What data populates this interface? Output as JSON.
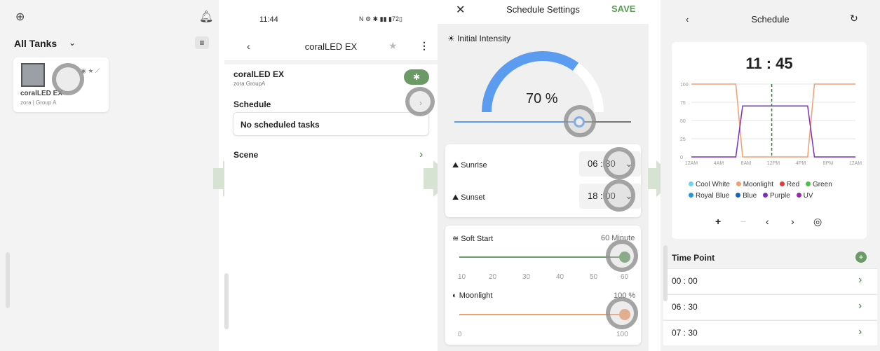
{
  "panel1": {
    "title": "All Tanks",
    "card": {
      "name": "coralLED EX",
      "sub": "zora | Group A"
    }
  },
  "panel2": {
    "status_time": "11:44",
    "header_title": "coralLED EX",
    "device_name": "coralLED EX",
    "device_sub": "zora GroupA",
    "schedule_label": "Schedule",
    "no_tasks": "No scheduled tasks",
    "scene_label": "Scene"
  },
  "panel3": {
    "header_title": "Schedule Settings",
    "save_label": "SAVE",
    "initial_intensity_label": "Initial Intensity",
    "intensity_value": "70 %",
    "intensity_level": 70,
    "sunrise_label": "Sunrise",
    "sunrise_value": "06 : 30",
    "sunset_label": "Sunset",
    "sunset_value": "18 : 00",
    "soft_start_label": "Soft Start",
    "soft_start_value": "60 Minute",
    "soft_start_ticks": [
      "10",
      "20",
      "30",
      "40",
      "50",
      "60"
    ],
    "moonlight_label": "Moonlight",
    "moonlight_value": "100 %",
    "moonlight_ticks": [
      "0",
      "100"
    ]
  },
  "panel4": {
    "header_title": "Schedule",
    "time_display": "11 : 45",
    "time_point_label": "Time Point",
    "time_points": [
      "00 : 00",
      "06 : 30",
      "07 : 30"
    ],
    "legend": [
      {
        "name": "Cool White",
        "color": "#6fd3f0"
      },
      {
        "name": "Moonlight",
        "color": "#f0a070"
      },
      {
        "name": "Red",
        "color": "#e53935"
      },
      {
        "name": "Green",
        "color": "#43c443"
      },
      {
        "name": "Royal Blue",
        "color": "#1e9bd6"
      },
      {
        "name": "Blue",
        "color": "#1565c0"
      },
      {
        "name": "Purple",
        "color": "#7b2fbf"
      },
      {
        "name": "UV",
        "color": "#9c27b0"
      }
    ],
    "chart_data": {
      "type": "line",
      "x_ticks": [
        "12AM",
        "4AM",
        "8AM",
        "12PM",
        "4PM",
        "8PM",
        "12AM"
      ],
      "y_ticks": [
        "0",
        "25",
        "50",
        "75",
        "100"
      ],
      "ylim": [
        0,
        100
      ],
      "series": [
        {
          "name": "Moonlight",
          "color": "#f0a070",
          "x": [
            0,
            6.5,
            7.5,
            17,
            18,
            24
          ],
          "y": [
            100,
            100,
            0,
            0,
            100,
            100
          ]
        },
        {
          "name": "Purple",
          "color": "#7b2fbf",
          "x": [
            0,
            6.5,
            7.5,
            17,
            18,
            24
          ],
          "y": [
            0,
            0,
            70,
            70,
            0,
            0
          ]
        }
      ],
      "current_time_hour": 11.75
    }
  }
}
